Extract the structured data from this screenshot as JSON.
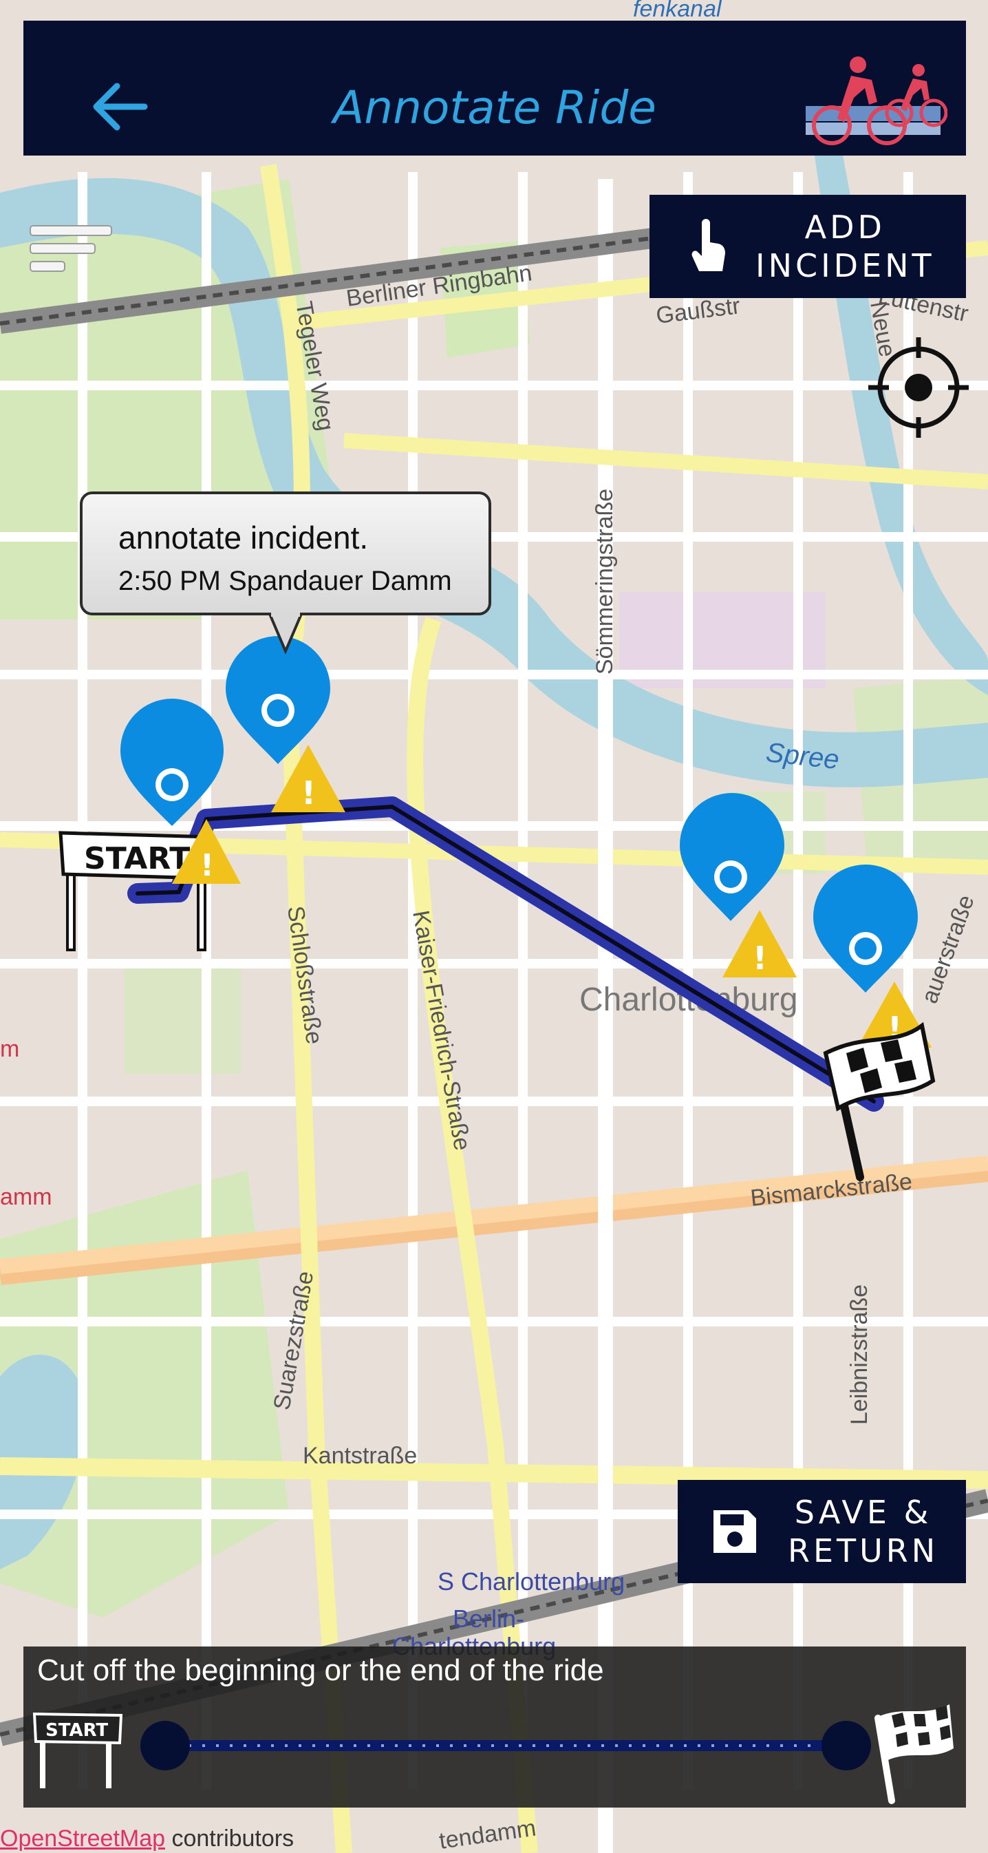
{
  "header": {
    "title": "Annotate Ride",
    "back_icon": "arrow-left-icon",
    "logo_icon": "cyclists-logo",
    "background": "#060f30",
    "title_color": "#2fa4e0"
  },
  "controls": {
    "add_incident_label": "ADD\nINCIDENT",
    "add_incident_icon": "tap-hand-icon",
    "save_return_label": "SAVE &\nRETURN",
    "save_icon": "floppy-disk-icon",
    "menu_icon": "menu-lines-icon",
    "locate_icon": "crosshair-locate-icon"
  },
  "tooltip": {
    "title": "annotate incident.",
    "subtitle": "2:50 PM Spandauer Damm"
  },
  "map": {
    "labels": {
      "ringbahn": "Berliner Ringbahn",
      "gauss": "Gaußstr",
      "tegeler": "Tegeler Weg",
      "sommering": "Sömmeringstraße",
      "spree": "Spree",
      "schloss": "Schloßstraße",
      "kaiser": "Kaiser-Friedrich-Straße",
      "charlottenburg": "Charlottenburg",
      "bismarck": "Bismarckstraße",
      "suarez": "Suarezstraße",
      "leibniz": "Leibnizstraße",
      "kant": "Kantstraße",
      "s_charlottenburg": "S Charlottenburg",
      "berlin": "Berlin-",
      "berlin2": "Charlottenburg",
      "neue": "Neue",
      "luttenstr": "Luttenstr",
      "auerstr": "auerstraße",
      "partial_m": "m",
      "partial_amm": "amm",
      "fenkanal": "fenkanal",
      "damm_bottom": "tendamm"
    },
    "start_sign": "START",
    "route_color": "#2b35a8",
    "marker_color": "#0b8ce0",
    "warning_color": "#f1c21b"
  },
  "slider": {
    "caption": "Cut off the beginning or the end of the ride",
    "start_label": "START",
    "finish_icon": "checkered-flag-icon"
  },
  "footer": {
    "credit_link": "OpenStreetMap",
    "credit_text": " contributors"
  }
}
